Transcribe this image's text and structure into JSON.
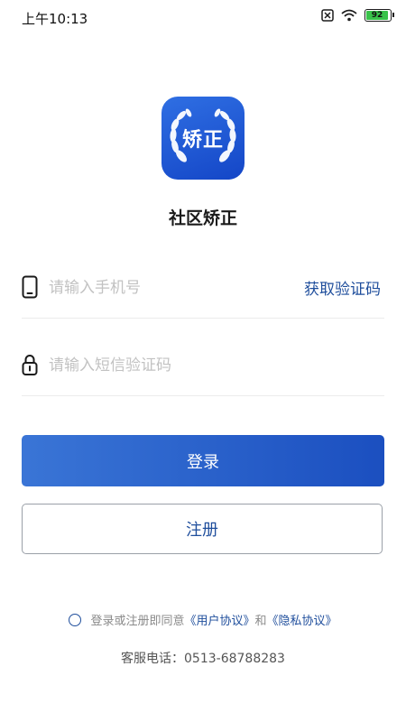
{
  "status_bar": {
    "time": "上午10:13",
    "battery_level": "92",
    "icons": [
      "sim-off-icon",
      "wifi-icon",
      "battery-icon"
    ]
  },
  "app": {
    "logo_text": "矫正",
    "name": "社区矫正"
  },
  "login_form": {
    "phone_placeholder": "请输入手机号",
    "phone_value": "",
    "get_code_label": "获取验证码",
    "code_placeholder": "请输入短信验证码",
    "code_value": "",
    "login_button_label": "登录",
    "register_button_label": "注册"
  },
  "agreement": {
    "checked": false,
    "prefix_text": "登录或注册即同意",
    "user_agreement_label": "《用户协议》",
    "and_text": "和",
    "privacy_agreement_label": "《隐私协议》"
  },
  "service": {
    "phone_text": "客服电话：0513-68788283"
  },
  "colors": {
    "primary_blue": "#1f4e9c",
    "button_gradient_start": "#3a75d6",
    "button_gradient_end": "#1b4fc0",
    "battery_green": "#39c24a"
  }
}
